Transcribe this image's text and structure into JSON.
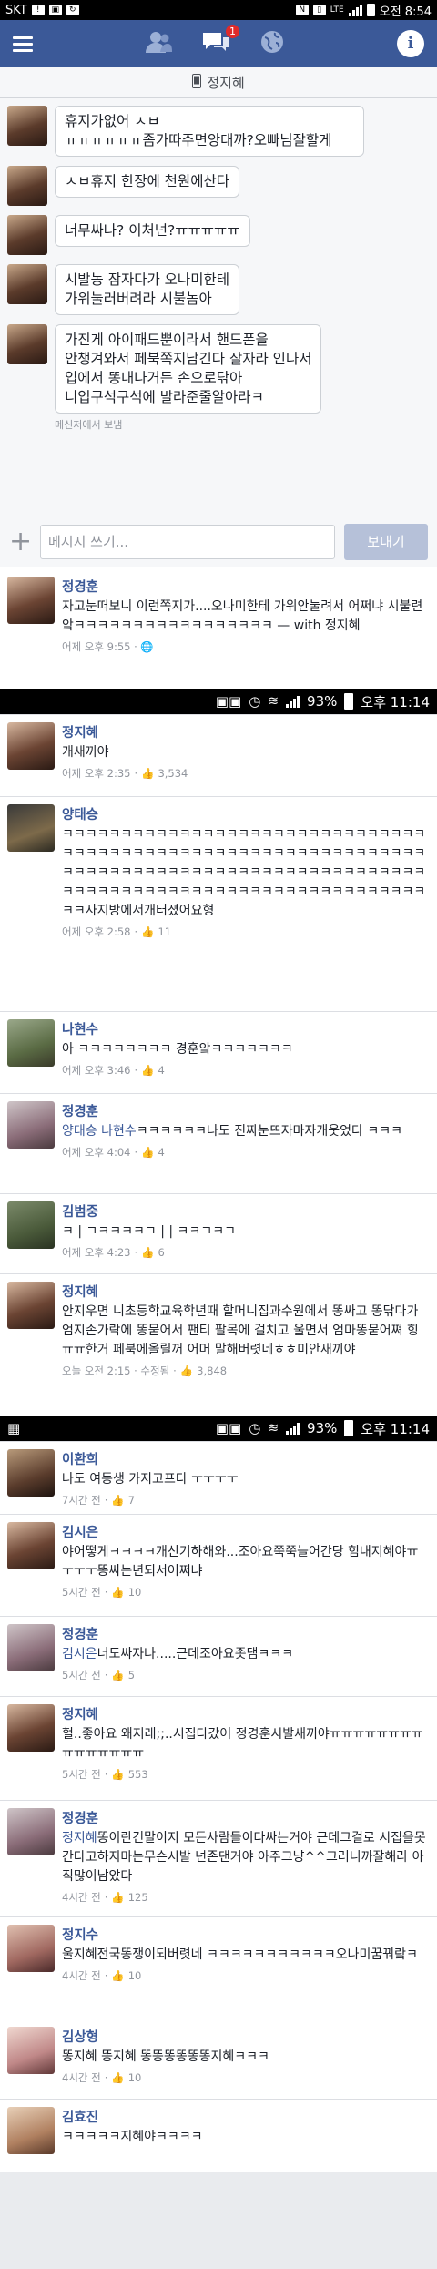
{
  "status_top": {
    "carrier": "SKT",
    "net": "LTE",
    "time": "오전 8:54"
  },
  "header": {
    "menu_icon": "menu-icon",
    "friends_icon": "friends-icon",
    "messages_icon": "messages-icon",
    "messages_badge": "1",
    "globe_icon": "globe-icon",
    "info_icon": "info-icon"
  },
  "chat": {
    "title": "정지혜",
    "messages": [
      "휴지가없어 ㅅㅂ\nㅠㅠㅠㅠㅠㅠ좀가따주면앙대까?오빠님잘할게",
      "ㅅㅂ휴지 한장에 천원에산다",
      "너무싸나? 이처넌?ㅠㅠㅠㅠㅠ",
      "시발농 잠자다가 오나미한테\n가위눌러버려라 시불놈아",
      "가진게 아이패드뿐이라서 핸드폰을\n안챙겨와서 페북쪽지남긴다 잘자라 인나서\n입에서 똥내나거든 손으로닦아\n니입구석구석에 발라준줄알아라ㅋ"
    ],
    "sent_note": "메신저에서 보냄",
    "composer_placeholder": "메시지 쓰기...",
    "send_label": "보내기"
  },
  "post1": {
    "name": "정경훈",
    "text": "자고눈떠보니 이런쪽지가....오나미한테 가위안눌려서 어쩌냐 시불련앜ㅋㅋㅋㅋㅋㅋㅋㅋㅋㅋㅋㅋㅋㅋㅋㅋㅋ — with 정지혜",
    "meta": "어제 오후 9:55 · 🌐"
  },
  "status_mid1": {
    "battery": "93%",
    "time": "오후 11:14"
  },
  "comments1": [
    {
      "name": "정지혜",
      "text": "개새끼야",
      "time": "어제 오후 2:35",
      "likes": "3,534"
    },
    {
      "name": "양태승",
      "text": "ㅋㅋㅋㅋㅋㅋㅋㅋㅋㅋㅋㅋㅋㅋㅋㅋㅋㅋㅋㅋㅋㅋㅋㅋㅋㅋㅋㅋㅋㅋㅋㅋㅋㅋㅋㅋㅋㅋㅋㅋㅋㅋㅋㅋㅋㅋㅋㅋㅋㅋㅋㅋㅋㅋㅋㅋㅋㅋㅋㅋㅋㅋㅋㅋㅋㅋㅋㅋㅋㅋㅋㅋㅋㅋㅋㅋㅋㅋㅋㅋㅋㅋㅋㅋㅋㅋㅋㅋㅋㅋㅋㅋㅋㅋㅋㅋㅋㅋㅋㅋㅋㅋㅋㅋㅋㅋㅋㅋㅋㅋㅋㅋㅋㅋㅋㅋㅋㅋㅋㅋㅋㅋㅋㅋㅋㅋ사지방에서개터졌어요형",
      "time": "어제 오후 2:58",
      "likes": "11"
    },
    {
      "name": "나현수",
      "text": "아 ㅋㅋㅋㅋㅋㅋㅋㅋ 경훈앜ㅋㅋㅋㅋㅋㅋㅋ",
      "time": "어제 오후 3:46",
      "likes": "4"
    },
    {
      "name": "정경훈",
      "tag": "양태승 나현수",
      "text": "ㅋㅋㅋㅋㅋㅋ나도 진짜눈뜨자마자개웃었다 ㅋㅋㅋ",
      "time": "어제 오후 4:04",
      "likes": "4"
    },
    {
      "name": "김범중",
      "text": "ㅋ | ㄱㅋㅋㅋㅋㄱ | | ㅋㅋㄱㅋㄱ",
      "time": "어제 오후 4:23",
      "likes": "6"
    },
    {
      "name": "정지혜",
      "text": "안지우면 니초등학교육학년때 할머니집과수원에서 똥싸고 똥닦다가 엄지손가락에 똥묻어서 팬티 팔목에 걸치고 울면서 엄마똥묻어쪄 힝ㅠㅠ한거 페북에올릴꺼 어머 말해버렷네ㅎㅎ미안새끼야",
      "time": "오늘 오전 2:15 · 수정됨",
      "likes": "3,848"
    }
  ],
  "status_mid2": {
    "battery": "93%",
    "time": "오후 11:14"
  },
  "comments2": [
    {
      "name": "이환희",
      "text": "나도 여동생 가지고프다 ㅜㅜㅜㅜ",
      "time": "7시간 전",
      "likes": "7"
    },
    {
      "name": "김시은",
      "text": "야어떻게ㅋㅋㅋㅋ개신기하해와...조아요쭉쭉늘어간당 힘내지혜야ㅠㅜㅜㅜ똥싸는년되서어쩌냐",
      "time": "5시간 전",
      "likes": "10"
    },
    {
      "name": "정경훈",
      "tag": "김시은",
      "text": "너도싸자나.....근데조아요좃댐ㅋㅋㅋ",
      "time": "5시간 전",
      "likes": "5"
    },
    {
      "name": "정지혜",
      "text": "헐..좋아요 왜저래;;..시집다갔어 정경훈시발새끼야ㅠㅠㅠㅠㅠㅠㅠㅠㅠㅠㅠㅠㅠㅠㅠ",
      "time": "5시간 전",
      "likes": "553"
    },
    {
      "name": "정경훈",
      "tag": "정지혜",
      "text": "똥이란건말이지 모든사람들이다싸는거야 근데그걸로 시집을못간다고하지마는무슨시발 넌존댄거야 아주그냥^^그러니까잘해라 아직많이남았다",
      "time": "4시간 전",
      "likes": "125"
    },
    {
      "name": "정지수",
      "text": "울지혜전국똥쟁이되버렷네 ㅋㅋㅋㅋㅋㅋㅋㅋㅋㅋㅋ오나미꿈꿔랔ㅋ",
      "time": "4시간 전",
      "likes": "10"
    },
    {
      "name": "김상형",
      "text": "똥지혜 똥지혜 똥똥똥똥똥똥지혜ㅋㅋㅋ",
      "time": "4시간 전",
      "likes": "10"
    },
    {
      "name": "김효진",
      "text": "ㅋㅋㅋㅋㅋ지혜야ㅋㅋㅋㅋ",
      "time": "",
      "likes": ""
    }
  ]
}
